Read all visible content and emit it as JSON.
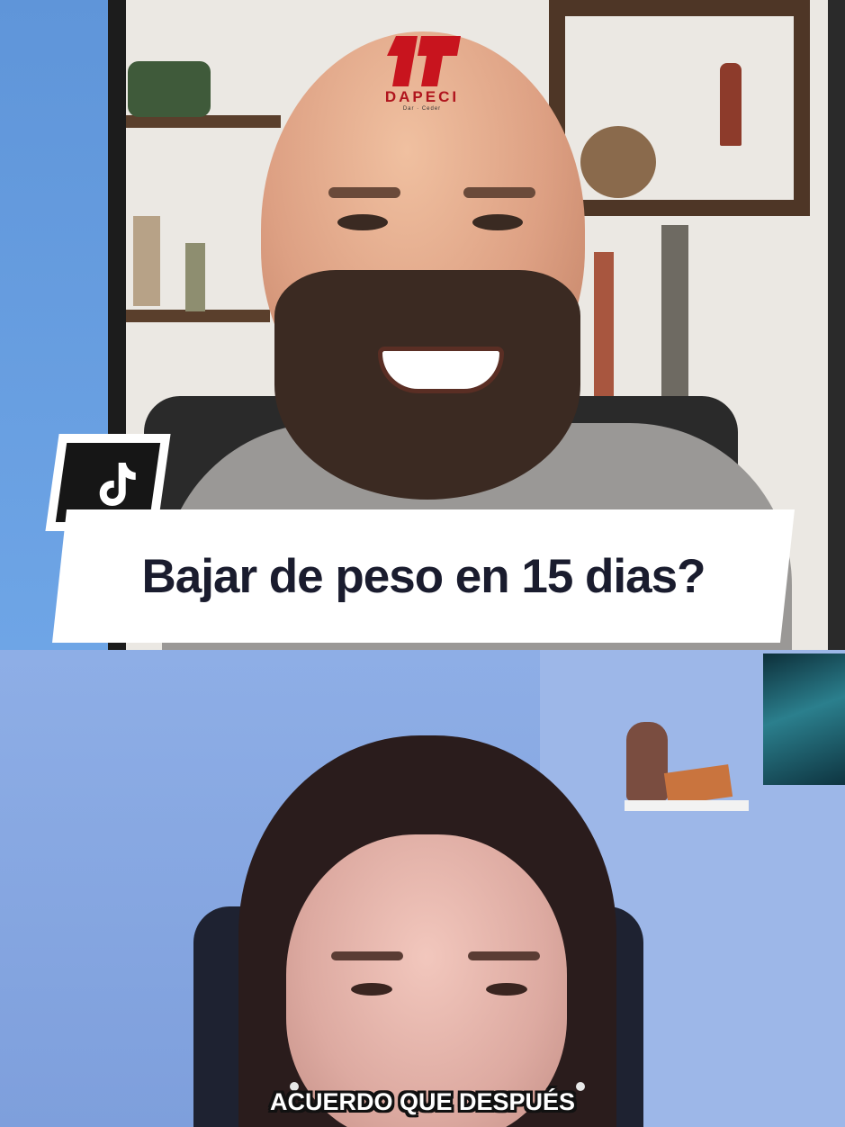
{
  "top_video": {
    "logo": {
      "name": "DAPECI",
      "sub": "Dar · Ceder"
    }
  },
  "title_banner": {
    "text": "Bajar de peso en 15 dias?"
  },
  "tiktok_badge": {
    "icon": "tiktok-icon"
  },
  "bottom_video": {
    "caption": "ACUERDO QUE DESPUÉS"
  },
  "colors": {
    "background_blue": "#6ea5e6",
    "banner_bg": "#ffffff",
    "banner_text": "#1a1c2e",
    "logo_red": "#b0141d",
    "caption_text": "#ffffff",
    "caption_outline": "#111111"
  }
}
